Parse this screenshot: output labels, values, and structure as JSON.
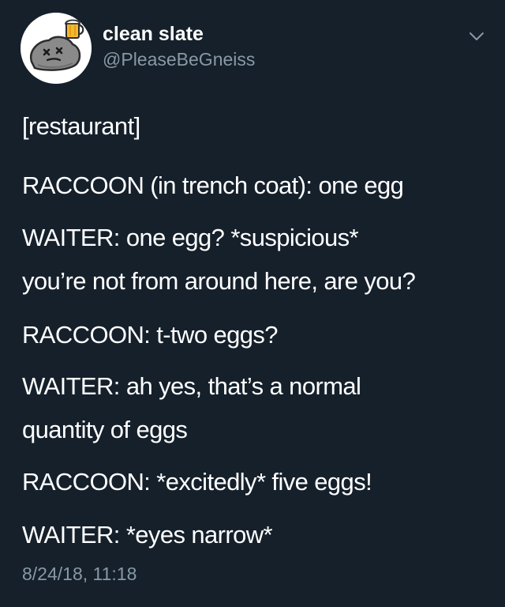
{
  "author": {
    "display_name": "clean slate",
    "handle": "@PleaseBeGneiss",
    "avatar_icon": "rock-with-beer-icon"
  },
  "menu": {
    "icon": "chevron-down-icon"
  },
  "tweet": {
    "lines": [
      "[restaurant]",
      "RACCOON (in trench coat): one egg",
      "WAITER: one egg? *suspicious*",
      "you’re not from around here, are you?",
      "RACCOON: t-two eggs?",
      "WAITER: ah yes, that’s a normal",
      "quantity of eggs",
      "RACCOON: *excitedly* five eggs!",
      "WAITER: *eyes narrow*"
    ],
    "timestamp": "8/24/18, 11:18"
  },
  "colors": {
    "background": "#15202b",
    "primary_text": "#ffffff",
    "secondary_text": "#8899a6"
  }
}
